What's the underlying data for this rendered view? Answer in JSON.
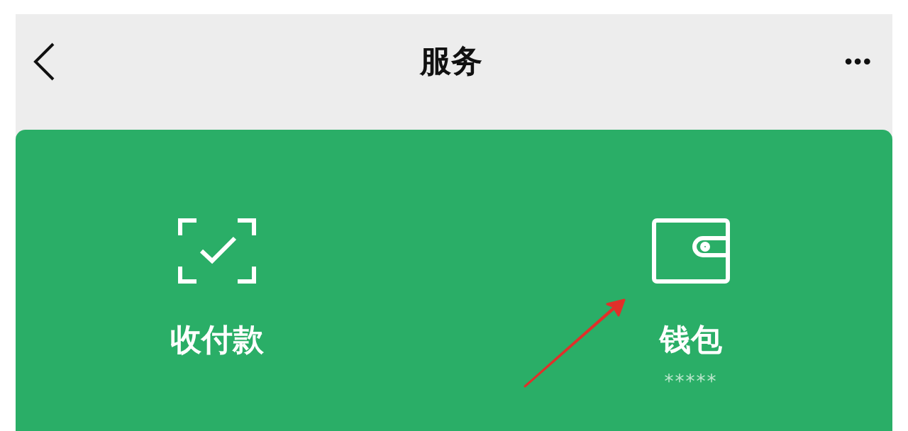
{
  "nav_bar": {
    "title": "服务",
    "more": "•••"
  },
  "services": [
    {
      "kind": "scan",
      "label": "收付款"
    },
    {
      "kind": "wallet",
      "label": "钱包",
      "balance": "*****"
    }
  ]
}
